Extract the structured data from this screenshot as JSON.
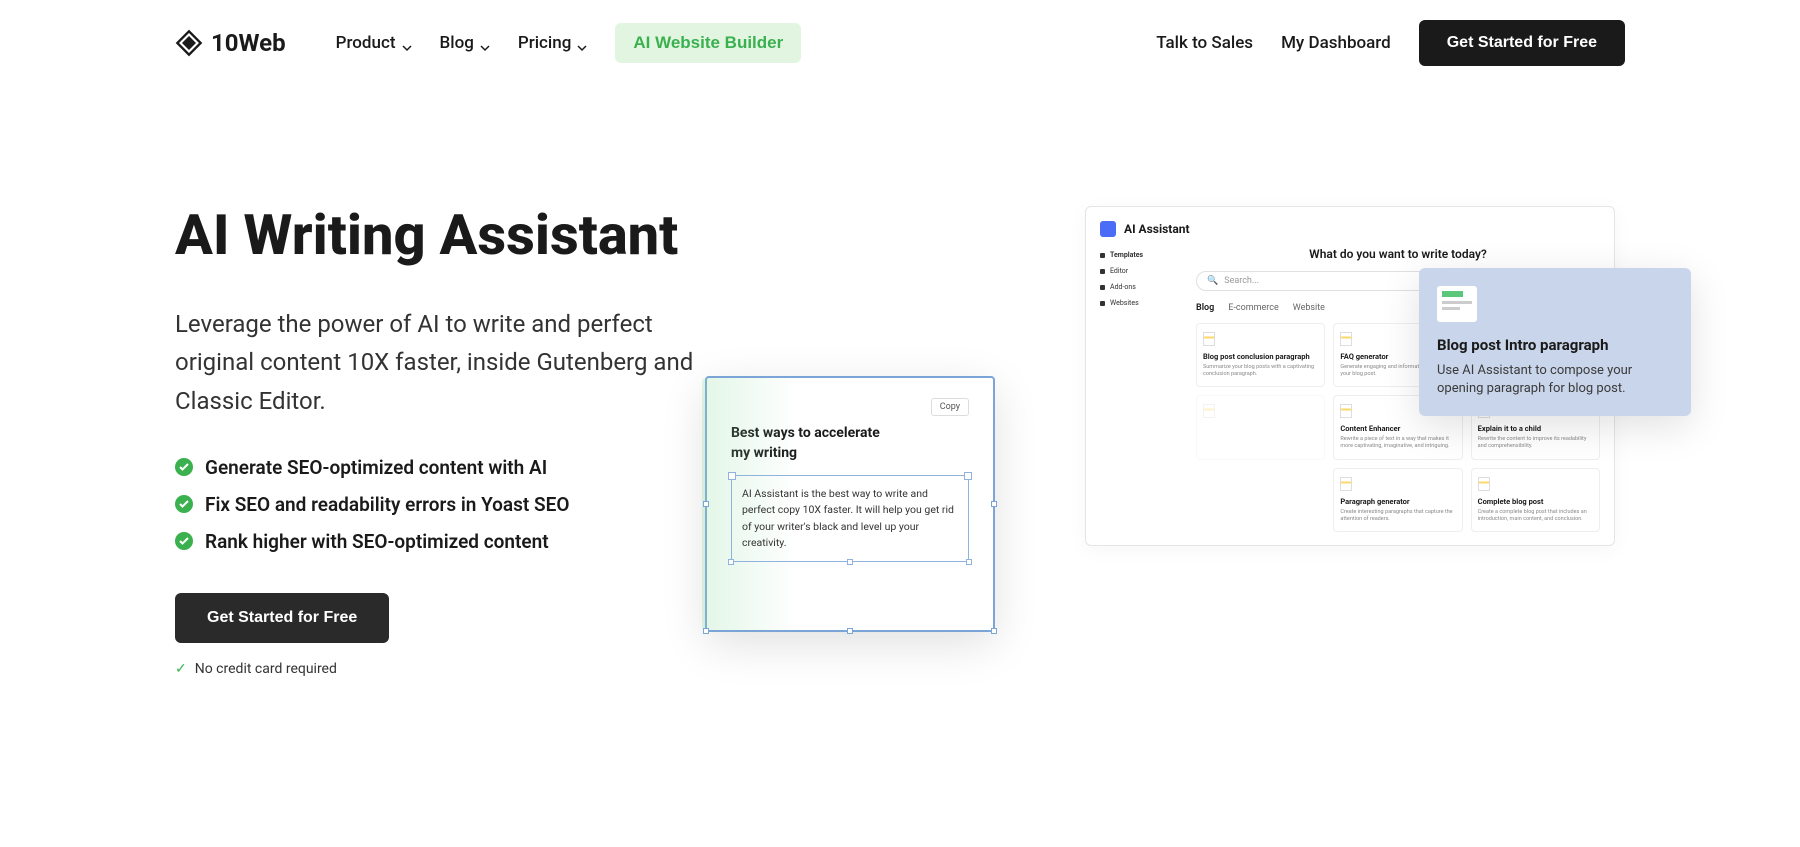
{
  "header": {
    "logo_text": "10Web",
    "nav": {
      "product": "Product",
      "blog": "Blog",
      "pricing": "Pricing",
      "ai_builder": "AI Website Builder",
      "talk_to_sales": "Talk to Sales",
      "dashboard": "My Dashboard",
      "get_started": "Get Started for Free"
    }
  },
  "hero": {
    "title": "AI Writing Assistant",
    "subtitle": "Leverage the power of AI to write and perfect original content 10X faster, inside Gutenberg and Classic Editor.",
    "features": {
      "f1": "Generate SEO-optimized content with AI",
      "f2": "Fix SEO and readability errors in Yoast SEO",
      "f3": "Rank higher with SEO-optimized content"
    },
    "cta": "Get Started for Free",
    "no_card": "No credit card required"
  },
  "mockup": {
    "assistant": {
      "title": "AI Assistant",
      "sidebar": {
        "s1": "Templates",
        "s2": "Editor",
        "s3": "Add-ons",
        "s4": "Websites"
      },
      "question": "What do you want to write today?",
      "search_placeholder": "Search...",
      "tabs": {
        "t1": "Blog",
        "t2": "E-commerce",
        "t3": "Website"
      },
      "cards": {
        "c1_title": "Blog post conclusion paragraph",
        "c1_desc": "Summarize your blog posts with a captivating conclusion paragraph.",
        "c2_title": "FAQ generator",
        "c2_desc": "Generate engaging and informative FAQ for your blog post.",
        "c3_title": "Content Enhancer",
        "c3_desc": "Rewrite a piece of text in a way that makes it more captivating, imaginative, and intriguing.",
        "c4_title": "Explain it to a child",
        "c4_desc": "Rewrite the content to improve its readability and comprehensibility.",
        "c5_title": "Paragraph generator",
        "c5_desc": "Create interesting paragraphs that capture the attention of readers.",
        "c6_title": "Complete blog post",
        "c6_desc": "Create a complete blog post that includes an introduction, main content, and conclusion."
      }
    },
    "popup": {
      "title": "Blog post Intro paragraph",
      "desc": "Use AI Assistant to compose your opening paragraph for blog post."
    },
    "editor": {
      "copy": "Copy",
      "title": "Best ways to accelerate my writing",
      "body": "AI Assistant is the best way to write and perfect copy 10X faster. It will help you get rid of your writer's black and level up your creativity."
    }
  }
}
